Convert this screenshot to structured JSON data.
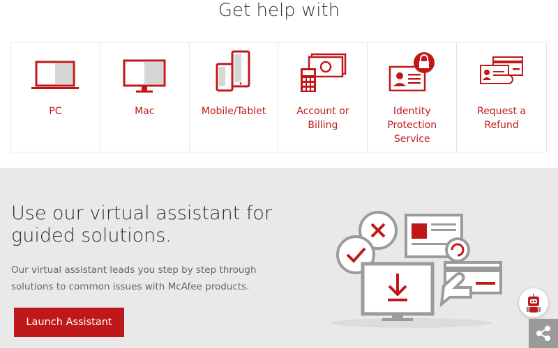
{
  "header": {
    "title": "Get help with"
  },
  "cards": [
    {
      "label": "PC",
      "icon": "laptop-icon"
    },
    {
      "label": "Mac",
      "icon": "monitor-icon"
    },
    {
      "label": "Mobile/Tablet",
      "icon": "mobile-tablet-icon"
    },
    {
      "label": "Account or Billing",
      "icon": "billing-icon"
    },
    {
      "label": "Identity Protection Service",
      "icon": "identity-lock-icon"
    },
    {
      "label": "Request a Refund",
      "icon": "refund-icon"
    }
  ],
  "assistant": {
    "title": "Use our virtual assistant for guided solutions.",
    "description": "Our virtual assistant leads you step by step through solutions to common issues with McAfee products.",
    "button_label": "Launch Assistant"
  },
  "colors": {
    "accent": "#c01818",
    "section_bg": "#e9e9ea",
    "icon_gray": "#d6d6d6"
  }
}
